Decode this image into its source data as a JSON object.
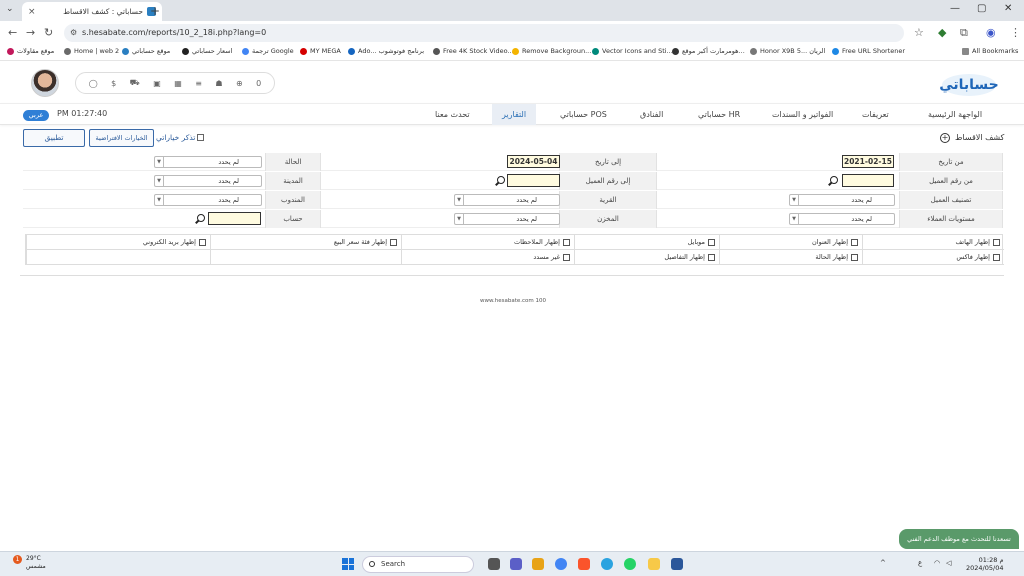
{
  "browser": {
    "tab_title": "حساباتي : كشف الاقساط",
    "tab_close": "×",
    "new_tab": "+",
    "url": "s.hesabate.com/reports/10_2_18i.php?lang=0",
    "bookmarks": [
      "موقع مقاولات",
      "Home | web 2",
      "موقع حساباتي",
      "اسعار حساباتي",
      "ترجمة Google",
      "MY MEGA",
      "Ado... برنامج فوتوشوب",
      "Free 4K Stock Video...",
      "Remove Backgroun...",
      "Vector Icons and Sti...",
      "هومرمارت أكبر موقع...",
      "Honor X9B 5... الريان",
      "Free URL Shortener"
    ],
    "all_bookmarks": "All Bookmarks"
  },
  "header": {
    "logo_text": "حساباتي",
    "icons": [
      "user-circle-icon",
      "dollar-icon",
      "car-icon",
      "bus-icon",
      "box-icon",
      "coins-icon",
      "robot-icon",
      "plus-circle-icon",
      "zero-badge-icon"
    ],
    "zero_count": "0"
  },
  "menu": {
    "items": [
      {
        "label": "الواجهة الرئيسية"
      },
      {
        "label": "تعريفات"
      },
      {
        "label": "الفواتير و السندات"
      },
      {
        "label": "حساباتي HR"
      },
      {
        "label": "الفنادق"
      },
      {
        "label": "حساباتي POS"
      },
      {
        "label": "التقارير"
      },
      {
        "label": "تحدث معنا"
      }
    ],
    "time": "PM 01:27:40",
    "lang": "عربي"
  },
  "report": {
    "title": "كشف الاقساط",
    "apply": "تطبيق",
    "defaults": "الخيارات الافتراضية",
    "remember": "تذكر خياراتي"
  },
  "form": {
    "from_date_label": "من تاريخ",
    "from_date": "2021-02-15",
    "to_date_label": "إلى تاريخ",
    "to_date": "2024-05-04",
    "status_label": "الحالة",
    "status_value": "لم يحدد",
    "from_client_label": "من رقم العميل",
    "to_client_label": "إلى رقم العميل",
    "city_label": "المدينة",
    "city_value": "لم يحدد",
    "client_class_label": "تصنيف العميل",
    "client_class_value": "لم يحدد",
    "village_label": "القرية",
    "village_value": "لم يحدد",
    "rep_label": "المندوب",
    "rep_value": "لم يحدد",
    "client_levels_label": "مستويات العملاء",
    "client_levels_value": "لم يحدد",
    "store_label": "المخزن",
    "store_value": "لم يحدد",
    "account_label": "حساب"
  },
  "checkboxes": {
    "row1": [
      "إظهار الهاتف",
      "إظهار العنوان",
      "موبايل",
      "إظهار الملاحظات",
      "إظهار فئة سعر البيع",
      "إظهار بريد الكتروني"
    ],
    "row2": [
      "إظهار فاكس",
      "إظهار الحالة",
      "إظهار التفاصيل",
      "غير مسدد"
    ]
  },
  "footer": {
    "text": "www.hesabate.com 100",
    "chat": "تسعدنا للتحدث مع موظف الدعم الفني"
  },
  "taskbar": {
    "weather_temp": "29°C",
    "weather_desc": "مشمس",
    "weather_badge": "1",
    "search": "Search",
    "lang": "ع",
    "time": "01:28 م",
    "date": "2024/05/04"
  },
  "colors": {
    "accent": "#2f7fd6",
    "input_bg": "#fffbe0",
    "chat_bg": "#5a9a6a"
  }
}
